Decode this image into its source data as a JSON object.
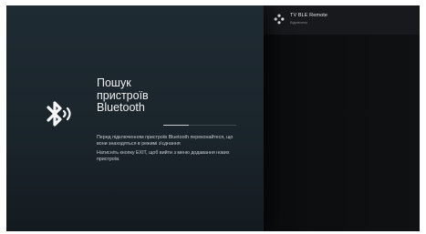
{
  "side_panel": {
    "device_name": "TV BLE Remote",
    "device_status": "Відхилено"
  },
  "dialog": {
    "title_lines": [
      "Пошук",
      "пристроїв",
      "Bluetooth"
    ],
    "progress": 0.35,
    "message_1": "Перед підключенням пристроїв Bluetooth переконайтеся, що вони знаходяться в режимі з'єднання",
    "message_2": "Натисніть кнопку EXIT, щоб вийти з меню додавання нових пристроїв."
  },
  "colors": {
    "panel_bg": "#1f2b33",
    "progress_fill": "#c7cbcf",
    "text": "#f0f0f0"
  },
  "icons": [
    "bluetooth-searching-icon",
    "gamepad-remote-icon"
  ]
}
